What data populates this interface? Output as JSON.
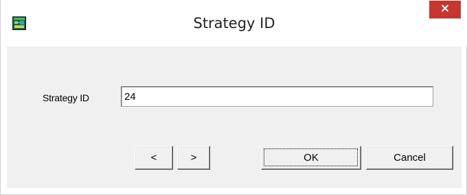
{
  "window": {
    "title": "Strategy ID",
    "app_icon": "app-icon",
    "close_icon": "close-icon",
    "close_color": "#c7362f"
  },
  "form": {
    "label": "Strategy ID",
    "value": "24"
  },
  "buttons": {
    "prev_label": "<",
    "next_label": ">",
    "ok_label": "OK",
    "cancel_label": "Cancel"
  }
}
